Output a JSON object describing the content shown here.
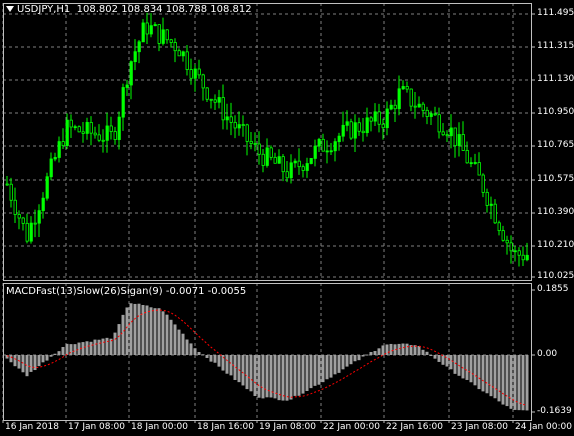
{
  "main_pane": {
    "symbol_period": "USDJPY,H1",
    "ohlc": "108.802 108.834 108.788 108.812",
    "price_labels": [
      "111.495",
      "111.315",
      "111.130",
      "110.950",
      "110.765",
      "110.575",
      "110.390",
      "110.210",
      "110.025"
    ]
  },
  "indicator_pane": {
    "header": "MACDFast(13)Slow(26)Sigan(9) -0.0071 -0.0055",
    "axis_labels": [
      "0.1855",
      "0.00",
      "-0.1639"
    ]
  },
  "time_axis": {
    "labels": [
      "16 Jan 2018",
      "17 Jan 08:00",
      "18 Jan 00:00",
      "18 Jan 16:00",
      "19 Jan 08:00",
      "22 Jan 00:00",
      "22 Jan 16:00",
      "23 Jan 08:00",
      "24 Jan 00:00"
    ]
  },
  "colors": {
    "background": "#000000",
    "grid": "#808080",
    "bull_candle": "#00ff00",
    "bear_candle": "#00ff00",
    "macd_histogram": "#a0a0a0",
    "signal_line": "#ff0000"
  },
  "chart_data": [
    {
      "type": "candlestick",
      "symbol": "USDJPY",
      "timeframe": "H1",
      "y_range": [
        110.025,
        111.495
      ],
      "trend_points": [
        {
          "t": "16 Jan 2018",
          "price": 110.6
        },
        {
          "t": "16 Jan 12:00",
          "price": 110.25
        },
        {
          "t": "17 Jan 08:00",
          "price": 110.85
        },
        {
          "t": "17 Jan 20:00",
          "price": 110.8
        },
        {
          "t": "18 Jan 00:00",
          "price": 111.2
        },
        {
          "t": "18 Jan 04:00",
          "price": 111.42
        },
        {
          "t": "18 Jan 12:00",
          "price": 111.3
        },
        {
          "t": "18 Jan 16:00",
          "price": 111.15
        },
        {
          "t": "19 Jan 00:00",
          "price": 110.92
        },
        {
          "t": "19 Jan 08:00",
          "price": 110.72
        },
        {
          "t": "19 Jan 16:00",
          "price": 110.6
        },
        {
          "t": "22 Jan 00:00",
          "price": 110.75
        },
        {
          "t": "22 Jan 08:00",
          "price": 110.85
        },
        {
          "t": "22 Jan 16:00",
          "price": 110.9
        },
        {
          "t": "22 Jan 20:00",
          "price": 111.05
        },
        {
          "t": "23 Jan 00:00",
          "price": 110.98
        },
        {
          "t": "23 Jan 08:00",
          "price": 110.85
        },
        {
          "t": "23 Jan 16:00",
          "price": 110.55
        },
        {
          "t": "24 Jan 00:00",
          "price": 110.15
        }
      ]
    },
    {
      "type": "bar",
      "name": "MACD",
      "y_range": [
        -0.1639,
        0.1855
      ],
      "trend_points": [
        {
          "t": "16 Jan 2018",
          "value": 0.0
        },
        {
          "t": "16 Jan 12:00",
          "value": -0.06
        },
        {
          "t": "17 Jan 08:00",
          "value": 0.03
        },
        {
          "t": "17 Jan 20:00",
          "value": 0.05
        },
        {
          "t": "18 Jan 00:00",
          "value": 0.15
        },
        {
          "t": "18 Jan 08:00",
          "value": 0.13
        },
        {
          "t": "18 Jan 16:00",
          "value": 0.02
        },
        {
          "t": "19 Jan 08:00",
          "value": -0.12
        },
        {
          "t": "19 Jan 16:00",
          "value": -0.13
        },
        {
          "t": "22 Jan 00:00",
          "value": -0.08
        },
        {
          "t": "22 Jan 16:00",
          "value": 0.03
        },
        {
          "t": "23 Jan 00:00",
          "value": 0.03
        },
        {
          "t": "23 Jan 08:00",
          "value": -0.04
        },
        {
          "t": "24 Jan 00:00",
          "value": -0.16
        }
      ]
    }
  ]
}
